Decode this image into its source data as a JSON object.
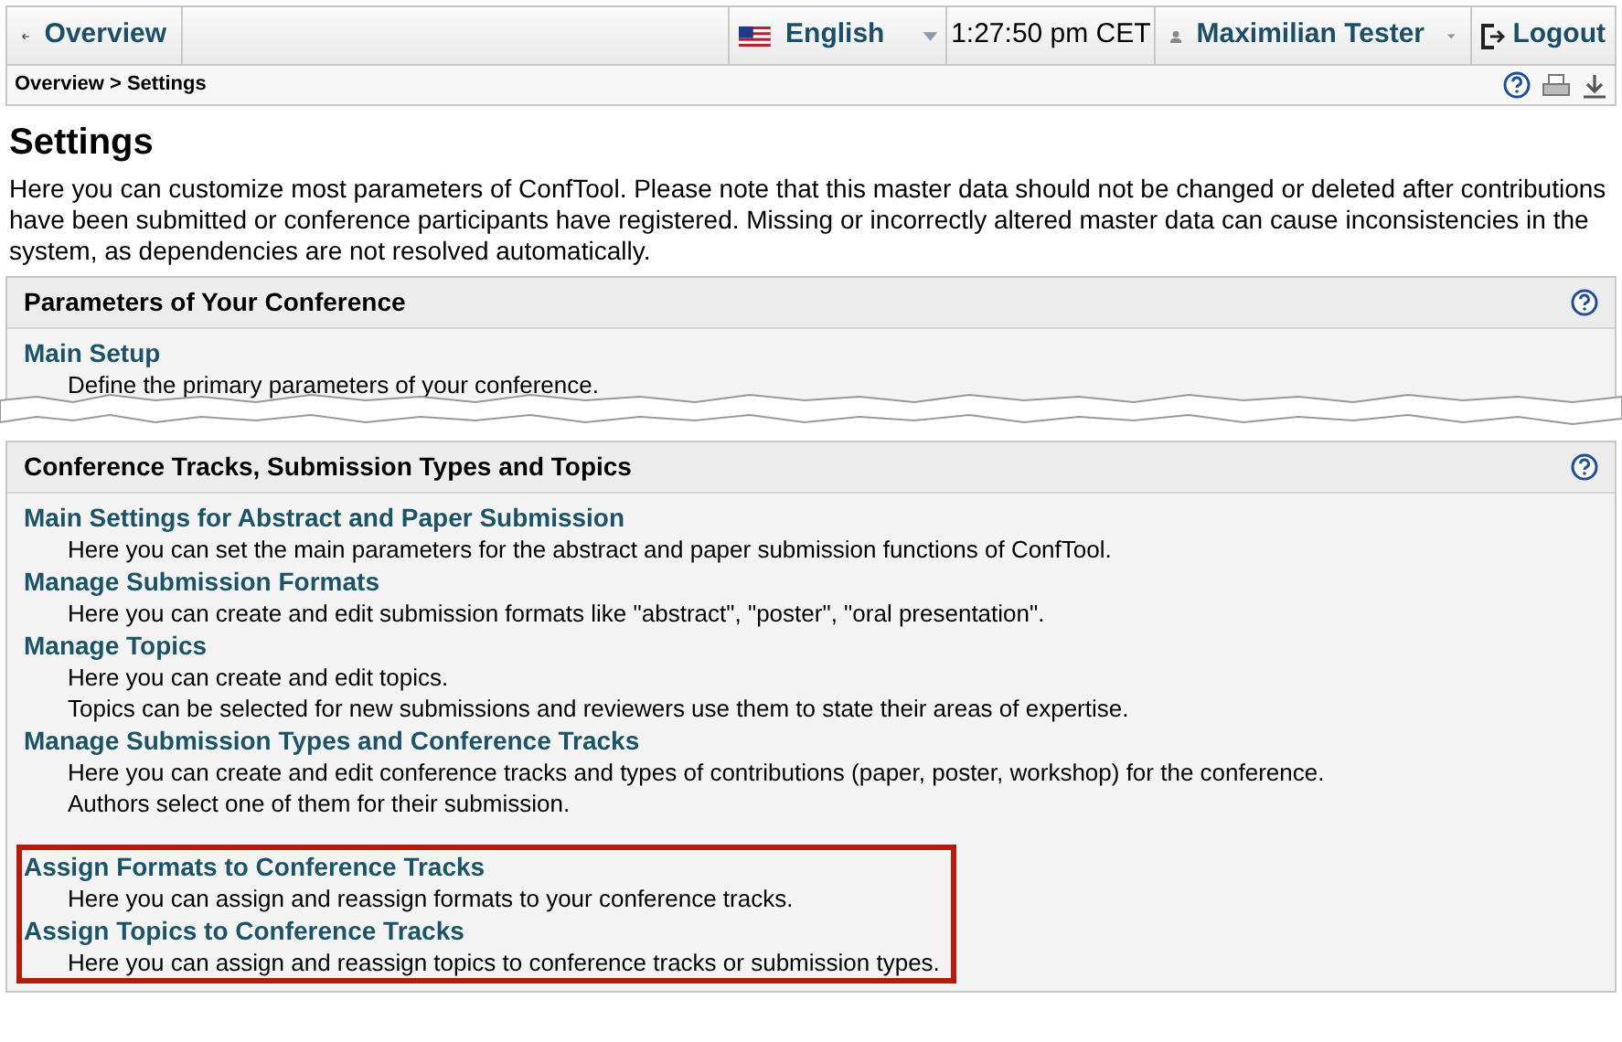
{
  "topbar": {
    "back": "Overview",
    "language": "English",
    "time": "1:27:50 pm CET",
    "user": "Maximilian Tester",
    "logout": "Logout"
  },
  "breadcrumb": "Overview > Settings",
  "title": "Settings",
  "intro": "Here you can customize most parameters of ConfTool. Please note that this master data should not be changed or deleted after contributions have been submitted or conference participants have registered. Missing or incorrectly altered master data can cause inconsistencies in the system, as dependencies are not resolved automatically.",
  "sections": [
    {
      "title": "Parameters of Your Conference",
      "groups": [
        {
          "highlighted": false,
          "items": [
            {
              "link": "Main Setup",
              "lines": [
                "Define the primary parameters of your conference."
              ]
            }
          ]
        }
      ]
    },
    {
      "title": "Conference Tracks, Submission Types and Topics",
      "groups": [
        {
          "highlighted": false,
          "items": [
            {
              "link": "Main Settings for Abstract and Paper Submission",
              "lines": [
                "Here you can set the main parameters for the abstract and paper submission functions of ConfTool."
              ]
            },
            {
              "link": "Manage Submission Formats",
              "lines": [
                "Here you can create and edit submission formats like \"abstract\", \"poster\", \"oral presentation\"."
              ]
            },
            {
              "link": "Manage Topics",
              "lines": [
                "Here you can create and edit topics.",
                "Topics can be selected for new submissions and reviewers use them to state their areas of expertise."
              ]
            },
            {
              "link": "Manage Submission Types and Conference Tracks",
              "lines": [
                "Here you can create and edit conference tracks and types of contributions (paper, poster, workshop) for the conference.",
                "Authors select one of them for their submission."
              ]
            }
          ]
        },
        {
          "highlighted": true,
          "items": [
            {
              "link": "Assign Formats to Conference Tracks",
              "lines": [
                "Here you can assign and reassign formats to your conference tracks."
              ]
            },
            {
              "link": "Assign Topics to Conference Tracks",
              "lines": [
                "Here you can assign and reassign topics to conference tracks or submission types."
              ]
            }
          ]
        }
      ]
    }
  ]
}
